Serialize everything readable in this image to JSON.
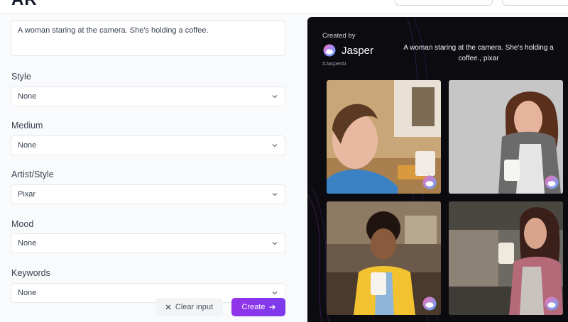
{
  "header": {
    "logo_fragment": "AR"
  },
  "form": {
    "prompt": "A woman staring at the camera. She's holding a coffee.",
    "fields": [
      {
        "label": "Style",
        "value": "None"
      },
      {
        "label": "Medium",
        "value": "None"
      },
      {
        "label": "Artist/Style",
        "value": "Pixar"
      },
      {
        "label": "Mood",
        "value": "None"
      },
      {
        "label": "Keywords",
        "value": "None"
      }
    ],
    "clear_label": "Clear input",
    "create_label": "Create"
  },
  "preview": {
    "created_by": "Created by",
    "brand": "Jasper",
    "hashtag": "#JasperAI",
    "caption": "A woman staring at the camera. She's holding a coffee., pixar"
  },
  "icons": {
    "chevron": "chevron-down-icon",
    "clear": "close-icon",
    "create": "arrow-right-icon",
    "brand": "jasper-logo-icon"
  },
  "colors": {
    "accent": "#7c3aed",
    "preview_bg": "#0b0b10"
  }
}
